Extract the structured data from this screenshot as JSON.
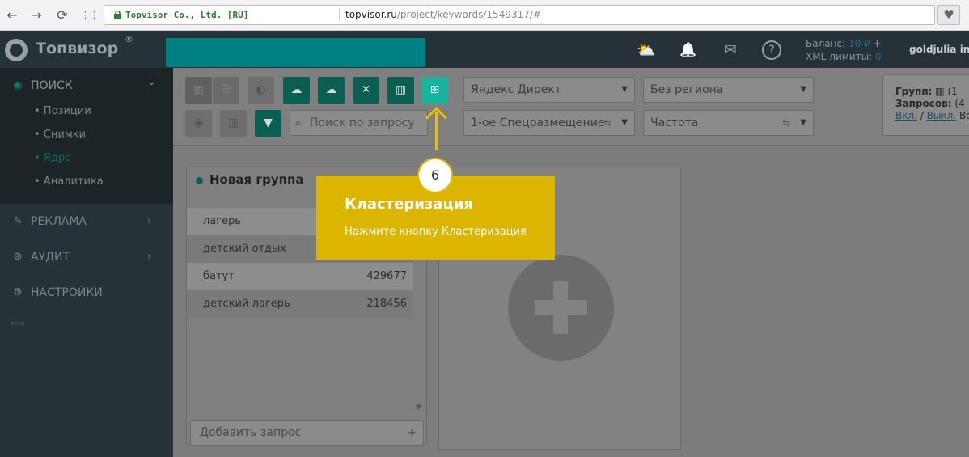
{
  "browser": {
    "back": "←",
    "forward": "→",
    "reload": "⟳",
    "apps": "⋮⋮",
    "site_identity": "Topvisor Co., Ltd. [RU]",
    "url_host": "topvisor.ru",
    "url_path": "/project/keywords/1549317/#",
    "fav": "♥"
  },
  "header": {
    "logo_text": "Топвизор",
    "logo_reg": "®",
    "icons": {
      "weather": "⛅",
      "bell": "🔔",
      "mail": "✉",
      "help": "?"
    },
    "balance_label": "Баланс:",
    "balance_value": "10 ₽",
    "balance_add": "+",
    "xml_label": "XML-лимиты:",
    "xml_value": "0",
    "user": "goldjulia inbo"
  },
  "sidebar": {
    "search": {
      "label": "ПОИСК",
      "chevron": "⌄"
    },
    "sub": [
      "• Позиции",
      "• Снимки",
      "• Ядро",
      "• Аналитика"
    ],
    "items": [
      {
        "label": "РЕКЛАМА",
        "chevron": "›"
      },
      {
        "label": "АУДИТ",
        "chevron": "›"
      },
      {
        "label": "НАСТРОЙКИ"
      }
    ],
    "collapse": "⟺"
  },
  "toolbar": {
    "search_placeholder": "Поиск по запросу",
    "engine": "Яндекс Директ",
    "region": "Без региона",
    "position": "1-ое Спецразмещение",
    "metric": "Частота",
    "arrow": "▼",
    "refresh": "⇆"
  },
  "summary": {
    "groups_label": "Групп:",
    "groups_val": "(1",
    "queries_label": "Запросов:",
    "queries_val": "(4",
    "on": "Вкл.",
    "sep": "/",
    "off": "Выкл.",
    "all": "Все"
  },
  "group": {
    "title": "Новая группа",
    "rows": [
      {
        "keyword": "лагерь",
        "value": ""
      },
      {
        "keyword": "детский отдых",
        "value": ""
      },
      {
        "keyword": "батут",
        "value": "429677"
      },
      {
        "keyword": "детский лагерь",
        "value": "218456"
      }
    ],
    "add_placeholder": "Добавить запрос",
    "add_plus": "+"
  },
  "tutorial": {
    "step": "6",
    "title": "Кластеризация",
    "text": "Нажмите кнопку Кластеризация"
  }
}
